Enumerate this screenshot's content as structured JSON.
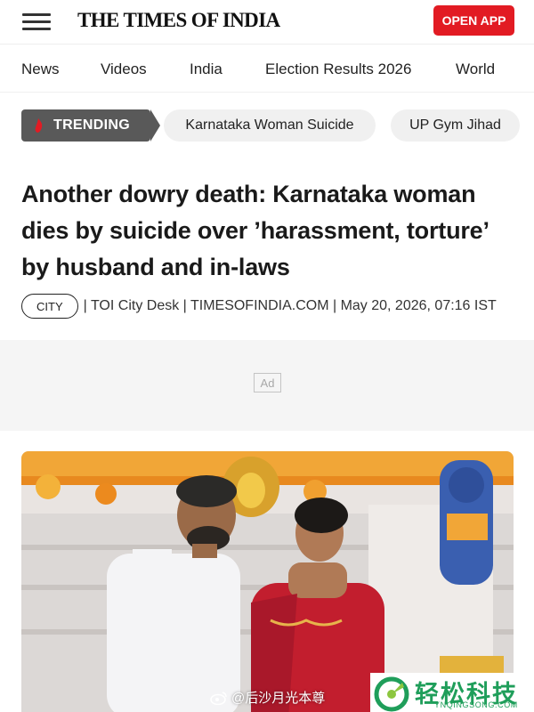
{
  "header": {
    "logo_text": "THE TIMES OF INDIA",
    "open_app_label": "OPEN APP",
    "menu_icon": "hamburger-icon",
    "brand_color": "#e21b23"
  },
  "nav": {
    "items": [
      "News",
      "Videos",
      "India",
      "Election Results 2026",
      "World"
    ]
  },
  "trending": {
    "badge_label": "TRENDING",
    "badge_icon": "flame-icon",
    "chips": [
      "Karnataka Woman Suicide",
      "UP Gym Jihad"
    ]
  },
  "article": {
    "headline": "Another dowry death: Karnataka woman dies by suicide over ’harassment, torture’ by husband and in-laws",
    "section_tag": "CITY",
    "byline": "| TOI City Desk | TIMESOFINDIA.COM | May 20, 2026, 07:16 IST"
  },
  "ad": {
    "label": "Ad"
  },
  "photo": {
    "watermark_text": "@后沙月光本尊",
    "watermark_icon": "weibo-icon"
  },
  "site_logo": {
    "name": "轻松科技",
    "url_text": "YNQINGSONG.COM",
    "color": "#1f9e5a"
  }
}
